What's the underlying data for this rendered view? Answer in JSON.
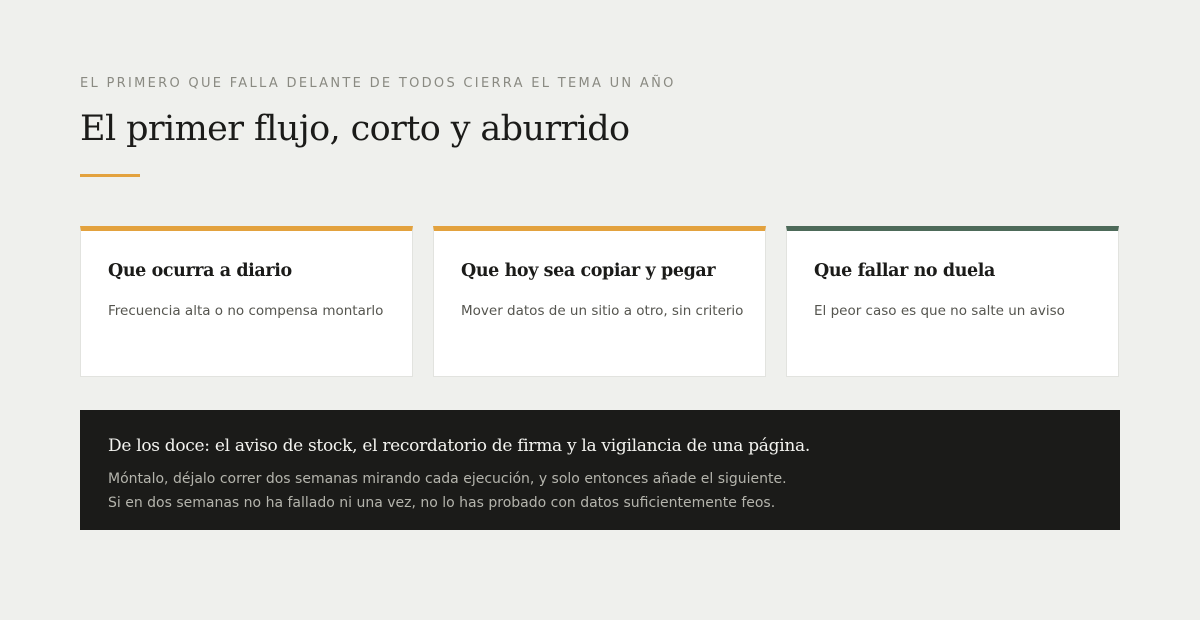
{
  "header": {
    "eyebrow": "EL PRIMERO QUE FALLA DELANTE DE TODOS CIERRA EL TEMA UN AÑO",
    "title": "El primer flujo, corto y aburrido"
  },
  "cards": [
    {
      "title": "Que ocurra a diario",
      "description": "Frecuencia alta o no compensa montarlo",
      "accent": "#e3a23e"
    },
    {
      "title": "Que hoy sea copiar y pegar",
      "description": "Mover datos de un sitio a otro, sin criterio",
      "accent": "#e3a23e"
    },
    {
      "title": "Que fallar no duela",
      "description": "El peor caso es que no salte un aviso",
      "accent": "#4d6a59"
    }
  ],
  "note": {
    "title": "De los doce: el aviso de stock, el recordatorio de firma y la vigilancia de una página.",
    "lines": [
      "Móntalo, déjalo correr dos semanas mirando cada ejecución, y solo entonces añade el siguiente.",
      "Si en dos semanas no ha fallado ni una vez, no lo has probado con datos suficientemente feos."
    ]
  },
  "colors": {
    "background": "#eff0ed",
    "accent": "#e3a23e",
    "green": "#4d6a59",
    "dark": "#1b1b19"
  }
}
